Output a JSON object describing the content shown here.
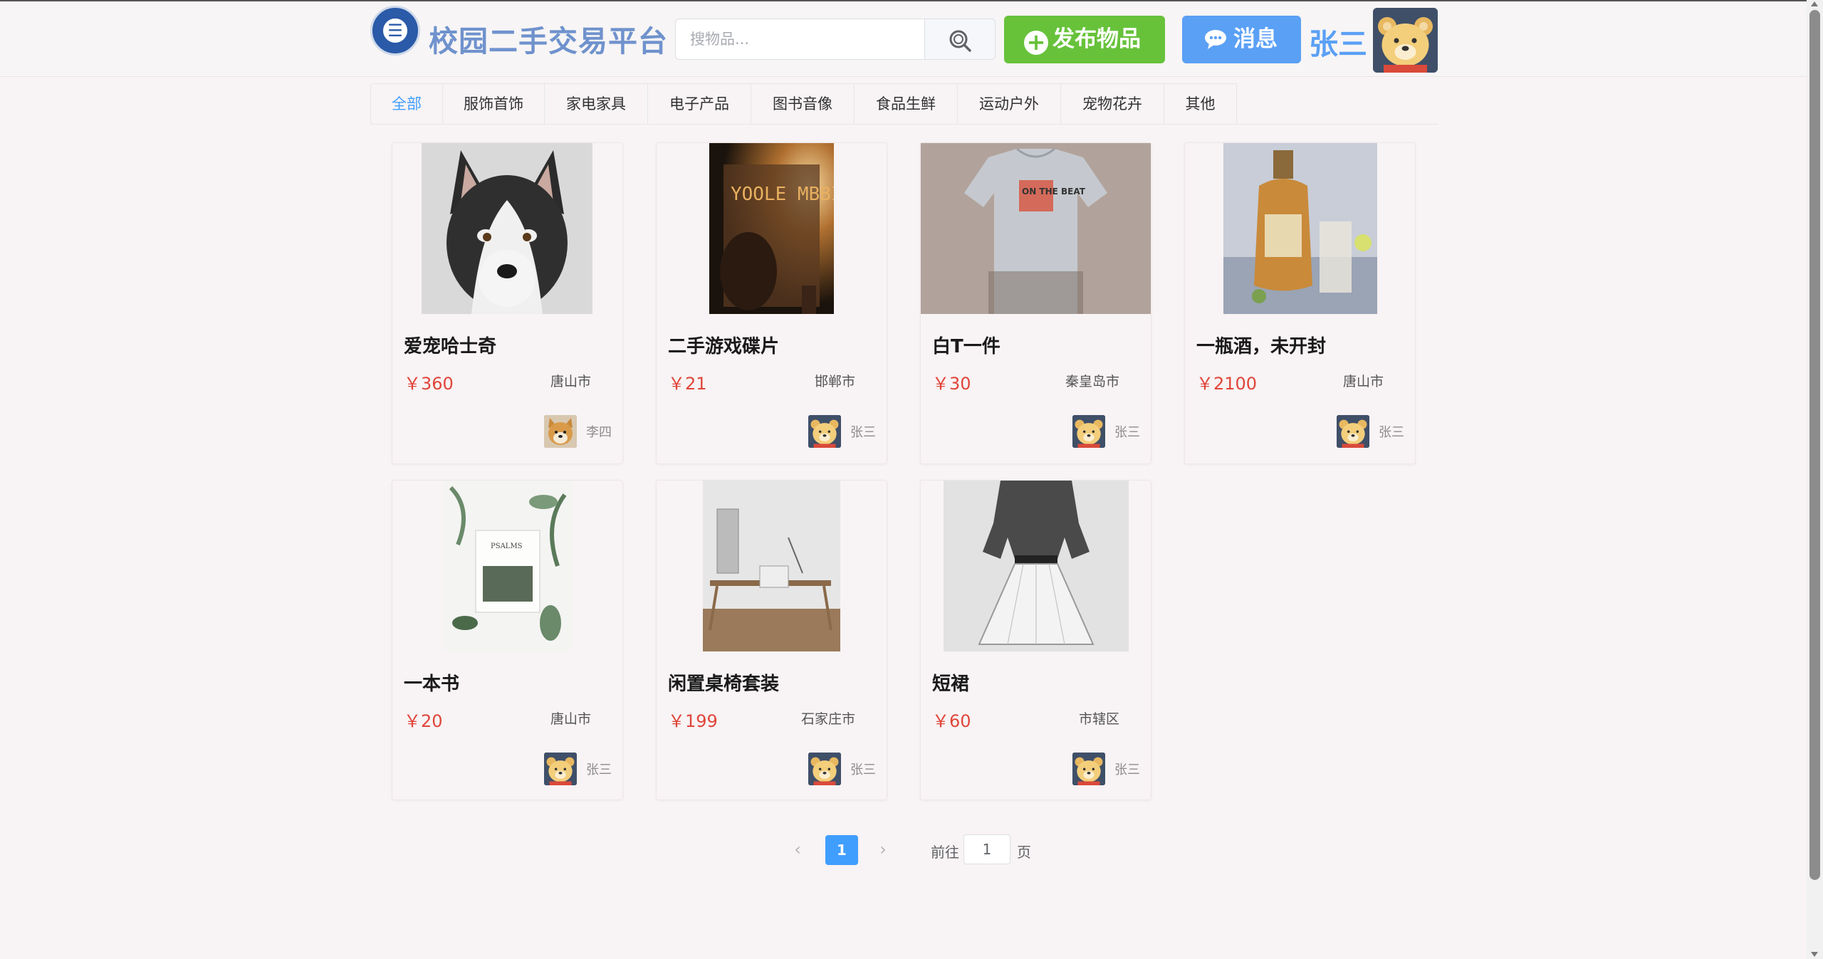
{
  "header": {
    "site_title": "校园二手交易平台",
    "search_placeholder": "搜物品...",
    "publish_label": "发布物品",
    "message_label": "消息",
    "username": "张三"
  },
  "categories": [
    {
      "label": "全部",
      "active": true
    },
    {
      "label": "服饰首饰",
      "active": false
    },
    {
      "label": "家电家具",
      "active": false
    },
    {
      "label": "电子产品",
      "active": false
    },
    {
      "label": "图书音像",
      "active": false
    },
    {
      "label": "食品生鲜",
      "active": false
    },
    {
      "label": "运动户外",
      "active": false
    },
    {
      "label": "宠物花卉",
      "active": false
    },
    {
      "label": "其他",
      "active": false
    }
  ],
  "items": [
    {
      "title": "爱宠哈士奇",
      "price": "￥360",
      "city": "唐山市",
      "seller": "李四",
      "image": "husky-dog"
    },
    {
      "title": "二手游戏碟片",
      "price": "￥21",
      "city": "邯郸市",
      "seller": "张三",
      "image": "game-disc-poster"
    },
    {
      "title": "白T一件",
      "price": "￥30",
      "city": "秦皇岛市",
      "seller": "张三",
      "image": "white-tshirt"
    },
    {
      "title": "一瓶酒，未开封",
      "price": "￥2100",
      "city": "唐山市",
      "seller": "张三",
      "image": "liquor-bottle"
    },
    {
      "title": "一本书",
      "price": "￥20",
      "city": "唐山市",
      "seller": "张三",
      "image": "book-with-leaves"
    },
    {
      "title": "闲置桌椅套装",
      "price": "￥199",
      "city": "石家庄市",
      "seller": "张三",
      "image": "desk-chair-set"
    },
    {
      "title": "短裙",
      "price": "￥60",
      "city": "市辖区",
      "seller": "张三",
      "image": "short-skirt"
    }
  ],
  "image_texts": {
    "game_poster": "YOOLE MBBIEM",
    "tshirt_print": "ON THE BEAT",
    "book_title": "PSALMS"
  },
  "pagination": {
    "current_page": "1",
    "goto_label": "前往",
    "goto_value": "1",
    "page_unit": "页"
  },
  "colors": {
    "primary": "#409eff",
    "publish": "#67c23a",
    "price": "#e0453a",
    "title": "#6f92cd"
  }
}
